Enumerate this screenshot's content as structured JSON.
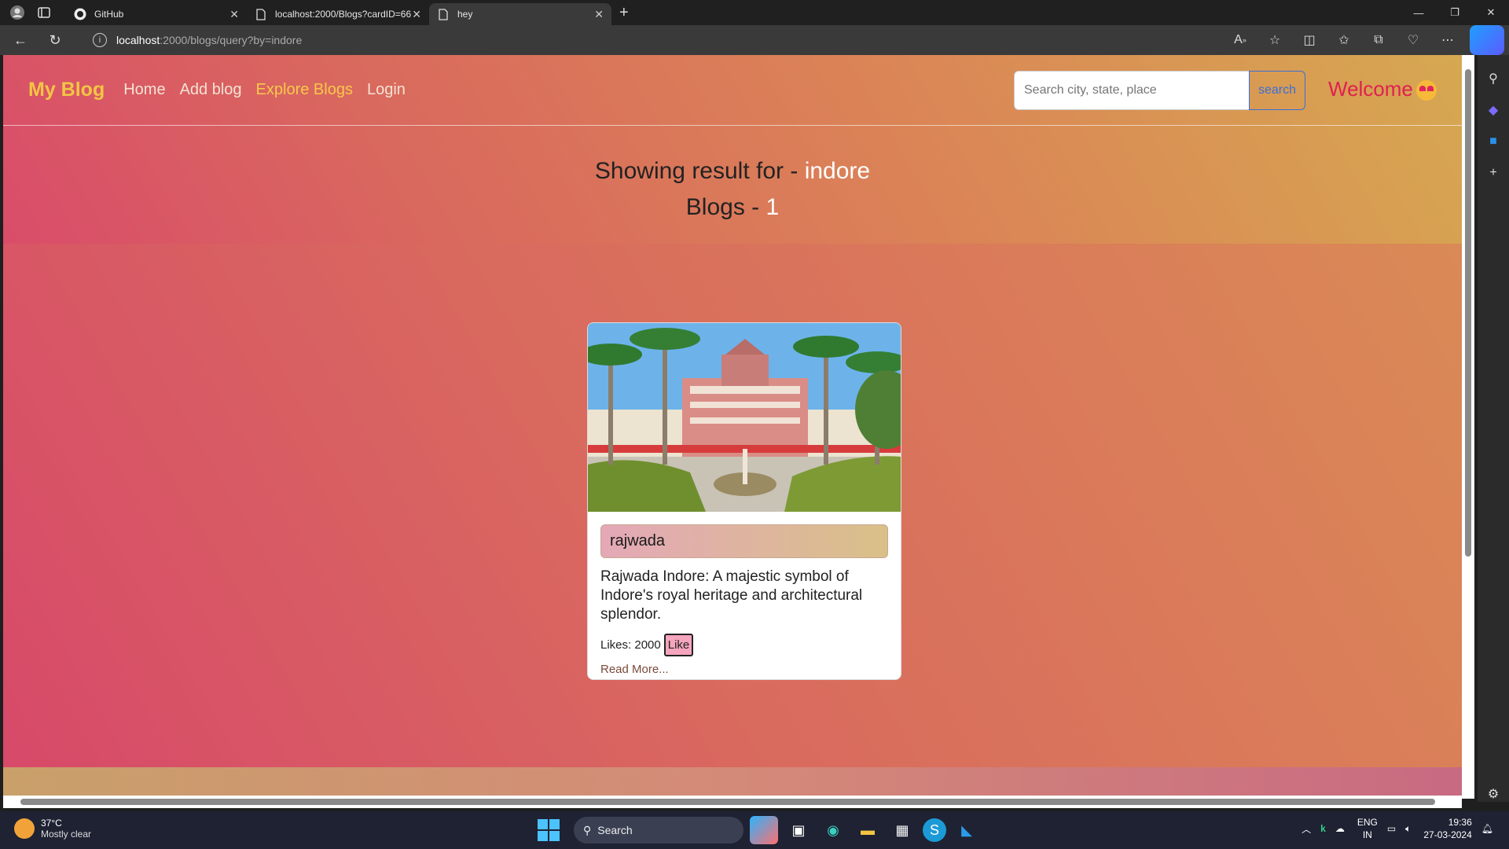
{
  "browser": {
    "tabs": [
      {
        "title": "GitHub",
        "icon": "github-icon"
      },
      {
        "title": "localhost:2000/Blogs?cardID=66",
        "icon": "page-icon"
      },
      {
        "title": "hey",
        "icon": "page-icon"
      }
    ],
    "url_host": "localhost",
    "url_path": ":2000/blogs/query?by=indore"
  },
  "site": {
    "brand": "My Blog",
    "nav": [
      "Home",
      "Add blog",
      "Explore Blogs",
      "Login"
    ],
    "search_placeholder": "Search city, state, place",
    "search_button": "search",
    "welcome": "Welcome"
  },
  "results": {
    "prefix": "Showing result for - ",
    "query": "indore",
    "count_prefix": "Blogs - ",
    "count": "1"
  },
  "card": {
    "title": "rajwada",
    "description": "Rajwada Indore: A majestic symbol of Indore's royal heritage and architectural splendor.",
    "likes_label": "Likes: 2000",
    "like_button": "Like",
    "read_more": "Read More..."
  },
  "taskbar": {
    "temp": "37°C",
    "weather": "Mostly clear",
    "search": "Search",
    "lang1": "ENG",
    "lang2": "IN",
    "time": "19:36",
    "date": "27-03-2024"
  },
  "colors": {
    "brand": "#f2c544",
    "active_nav": "#f7c94a",
    "welcome": "#e02050",
    "like_button": "#f5a5bd"
  }
}
